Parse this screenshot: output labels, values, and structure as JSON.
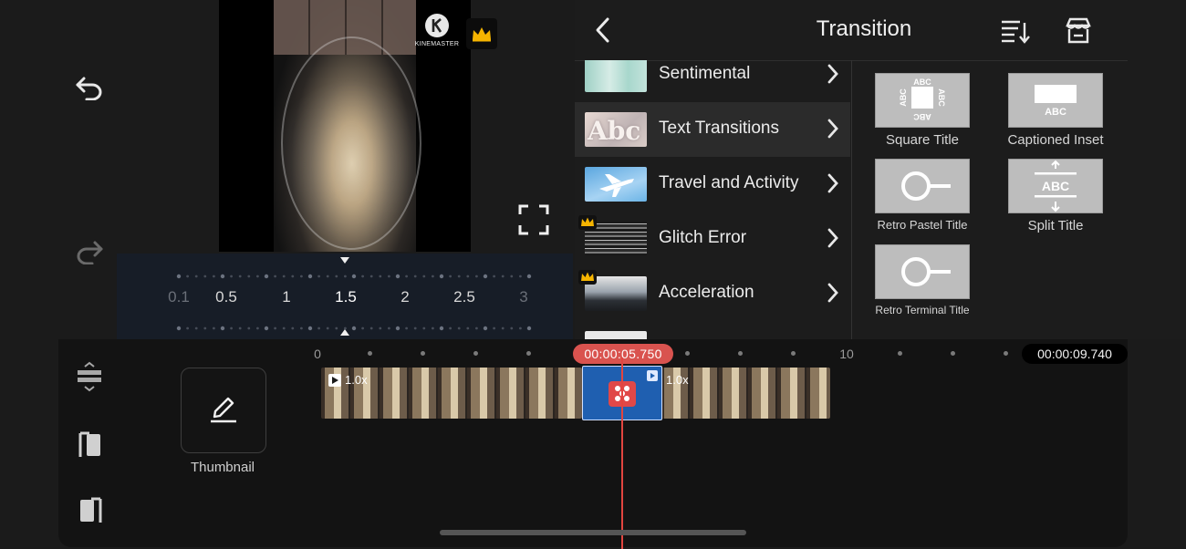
{
  "left_rail": {
    "undo_icon": "undo-icon",
    "redo_icon": "redo-icon"
  },
  "preview": {
    "watermark_text": "KINEMASTER",
    "crown_icon": "crown-icon",
    "fullscreen_icon": "fullscreen-icon"
  },
  "speed": {
    "labels": [
      "0.1",
      "0.5",
      "1",
      "1.5",
      "2",
      "2.5",
      "3"
    ],
    "selected": "1.5"
  },
  "panel": {
    "title": "Transition",
    "back_icon": "back-chevron-icon",
    "sort_icon": "sort-icon",
    "store_icon": "store-icon",
    "categories": [
      {
        "label": "Sentimental",
        "premium": false
      },
      {
        "label": "Text Transitions",
        "premium": false,
        "selected": true
      },
      {
        "label": "Travel and Activity",
        "premium": false
      },
      {
        "label": "Glitch Error",
        "premium": true
      },
      {
        "label": "Acceleration",
        "premium": true
      }
    ],
    "thumb_text": "Abc",
    "tiles": [
      {
        "label": "Square Title",
        "art": "ABC"
      },
      {
        "label": "Captioned Inset",
        "art": "ABC"
      },
      {
        "label": "Retro Pastel Title"
      },
      {
        "label": "Split Title",
        "art": "ABC"
      },
      {
        "label": "Retro Terminal Title"
      }
    ]
  },
  "timeline": {
    "ruler_start": "0",
    "ruler_end": "10",
    "current_time": "00:00:05.750",
    "total_time": "00:00:09.740",
    "clip1_speed": "1.0x",
    "clip2_speed": "1.0x",
    "thumbnail_label": "Thumbnail",
    "thumbnail_icon": "pencil-icon"
  }
}
